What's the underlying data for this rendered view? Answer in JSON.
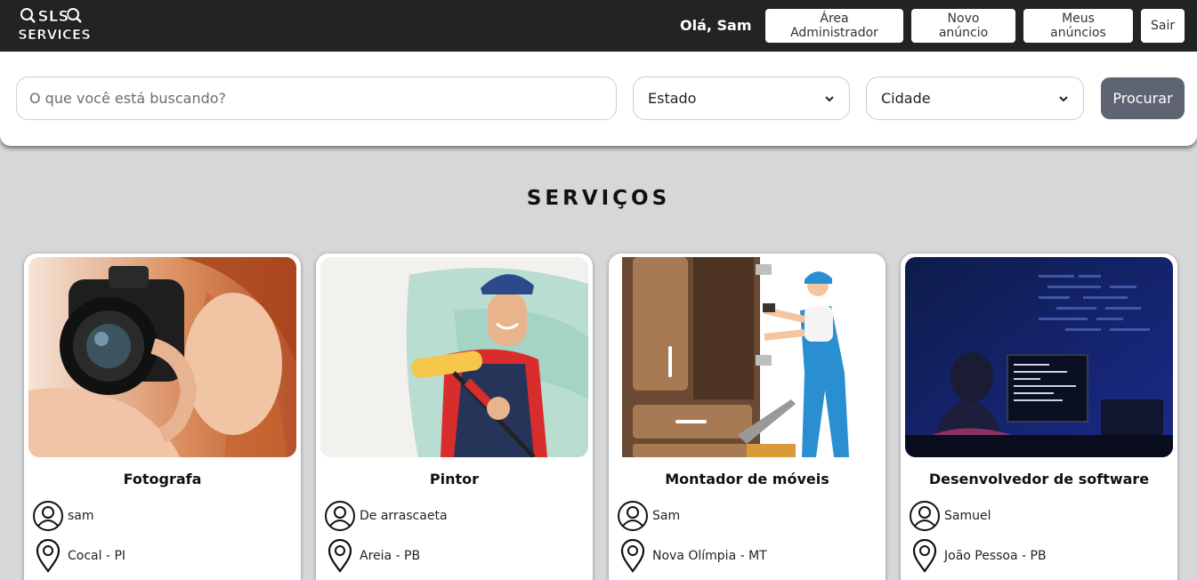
{
  "header": {
    "logo_text_top": "SLS",
    "logo_text_bottom": "SERVICES",
    "greeting": "Olá, Sam",
    "buttons": [
      "Área Administrador",
      "Novo anúncio",
      "Meus anúncios",
      "Sair"
    ]
  },
  "search": {
    "placeholder": "O que você está buscando?",
    "value": "",
    "estado": "Estado",
    "cidade": "Cidade",
    "submit": "Procurar"
  },
  "section_title": "SERVIÇOS",
  "cards": [
    {
      "title": "Fotografa",
      "user": "sam",
      "location": "Cocal - PI",
      "image": "photographer"
    },
    {
      "title": "Pintor",
      "user": "De arrascaeta",
      "location": "Areia - PB",
      "image": "painter"
    },
    {
      "title": "Montador de móveis",
      "user": "Sam",
      "location": "Nova Olímpia - MT",
      "image": "furniture-assembler"
    },
    {
      "title": "Desenvolvedor de software",
      "user": "Samuel",
      "location": "João Pessoa - PB",
      "image": "software-developer"
    }
  ],
  "colors": {
    "topbar": "#222324",
    "background": "#d6d7d9",
    "search_button": "#5f6472"
  }
}
